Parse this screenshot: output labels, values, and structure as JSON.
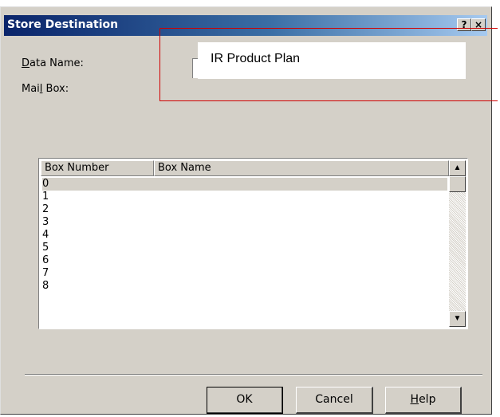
{
  "dialog": {
    "title": "Store Destination",
    "help_glyph": "?",
    "close_glyph": "×"
  },
  "fields": {
    "data_name_label_accel": "D",
    "data_name_label_rest": "ata Name:",
    "mailbox_label_pre": "Mai",
    "mailbox_label_accel": "l",
    "mailbox_label_rest": " Box:",
    "data_name_value": "IR Product Plan"
  },
  "list": {
    "columns": [
      "Box Number",
      "Box Name"
    ],
    "rows": [
      "0",
      "1",
      "2",
      "3",
      "4",
      "5",
      "6",
      "7",
      "8"
    ],
    "selected_index": 0
  },
  "buttons": {
    "ok": "OK",
    "cancel": "Cancel",
    "help_accel": "H",
    "help_rest": "elp"
  },
  "icons": {
    "scroll_up": "▲",
    "scroll_down": "▼"
  },
  "colors": {
    "callout": "#d00000",
    "dialog_face": "#d4d0c8",
    "title_start": "#0a246a"
  }
}
